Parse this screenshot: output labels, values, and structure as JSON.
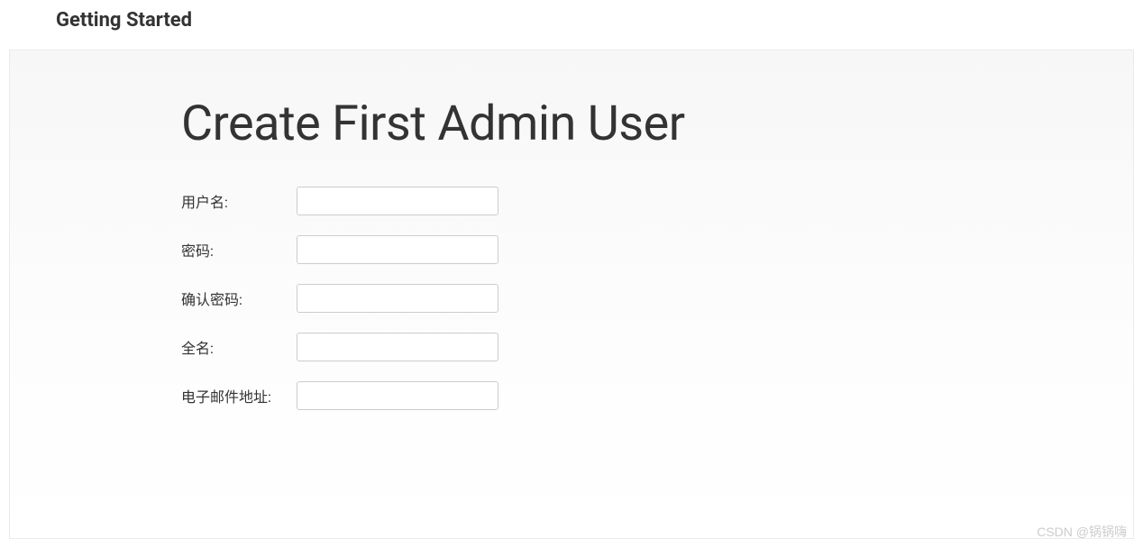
{
  "header": {
    "title": "Getting Started"
  },
  "panel": {
    "title": "Create First Admin User"
  },
  "form": {
    "username": {
      "label": "用户名:",
      "value": ""
    },
    "password": {
      "label": "密码:",
      "value": ""
    },
    "confirm_password": {
      "label": "确认密码:",
      "value": ""
    },
    "fullname": {
      "label": "全名:",
      "value": ""
    },
    "email": {
      "label": "电子邮件地址:",
      "value": ""
    }
  },
  "watermark": "CSDN @锅锅嗨"
}
